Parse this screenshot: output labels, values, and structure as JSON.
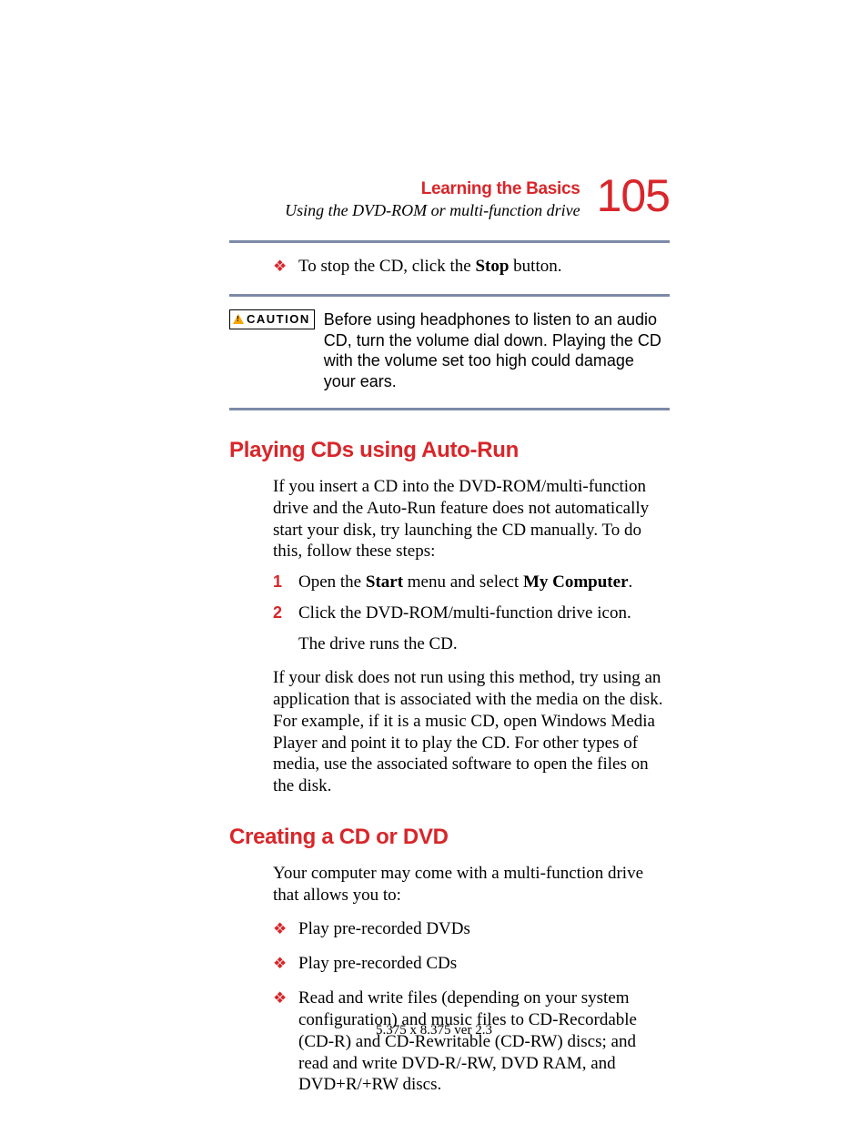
{
  "header": {
    "chapter": "Learning the Basics",
    "section": "Using the DVD-ROM or multi-function drive",
    "page_number": "105"
  },
  "top_bullet": {
    "pre": "To stop the CD, click the ",
    "bold": "Stop",
    "post": " button."
  },
  "caution": {
    "label": "CAUTION",
    "text": "Before using headphones to listen to an audio CD, turn the volume dial down. Playing the CD with the volume set too high could damage your ears."
  },
  "section1": {
    "heading": "Playing CDs using Auto-Run",
    "intro": "If you insert a CD into the DVD-ROM/multi-function drive and the Auto-Run feature does not automatically start your disk, try launching the CD manually. To do this, follow these steps:",
    "steps": [
      {
        "num": "1",
        "pre": "Open the ",
        "b1": "Start",
        "mid": " menu and select ",
        "b2": "My Computer",
        "post": "."
      },
      {
        "num": "2",
        "text": "Click the DVD-ROM/multi-function drive icon.",
        "sub": "The drive runs the CD."
      }
    ],
    "outro": "If your disk does not run using this method, try using an application that is associated with the media on the disk. For example, if it is a music CD, open Windows Media Player and point it to play the CD. For other types of media, use the associated software to open the files on the disk."
  },
  "section2": {
    "heading": "Creating a CD or DVD",
    "intro": "Your computer may come with a multi-function drive that allows you to:",
    "bullets": [
      "Play pre-recorded DVDs",
      "Play pre-recorded CDs",
      "Read and write files (depending on your system configuration) and music files to CD-Recordable (CD-R) and CD-Rewritable (CD-RW) discs; and read and write DVD-R/-RW, DVD RAM, and DVD+R/+RW discs."
    ]
  },
  "footer": "5.375 x 8.375 ver 2.3"
}
